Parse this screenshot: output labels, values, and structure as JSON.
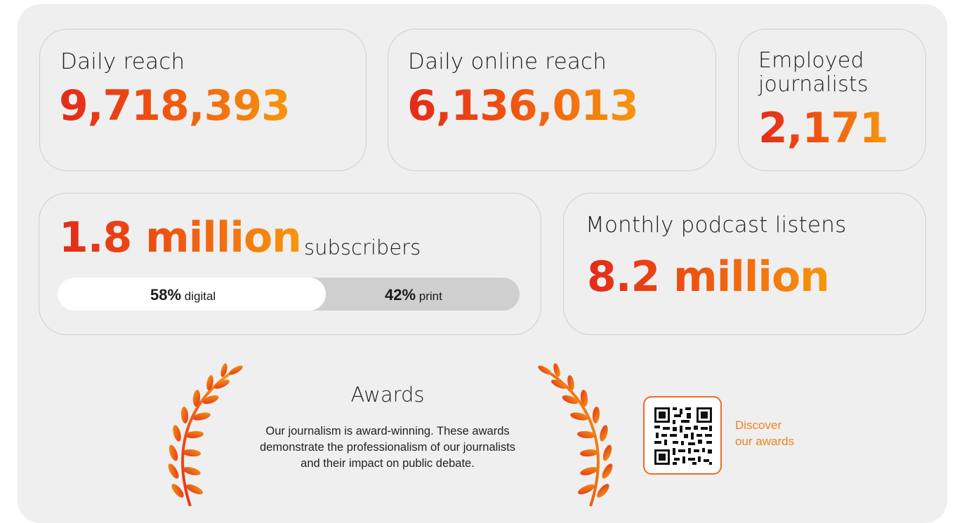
{
  "stats": {
    "daily_reach": {
      "label": "Daily reach",
      "value": "9,718,393"
    },
    "daily_online_reach": {
      "label": "Daily online reach",
      "value": "6,136,013"
    },
    "employed_journalists": {
      "label_line1": "Employed",
      "label_line2": "journalists",
      "value": "2,171"
    },
    "subscribers": {
      "value": "1.8 million",
      "label": "subscribers",
      "digital_percent": "58%",
      "digital_label": "digital",
      "print_percent": "42%",
      "print_label": "print",
      "digital_fraction": 0.58
    },
    "podcast": {
      "label": "Monthly podcast listens",
      "value": "8.2 million"
    }
  },
  "awards": {
    "title": "Awards",
    "description_line1": "Our journalism is award-winning. These awards",
    "description_line2": "demonstrate the professionalism of our journalists",
    "description_line3": "and their impact on public debate.",
    "link_line1": "Discover",
    "link_line2": "our awards",
    "qr_icon": "qr-code-icon"
  },
  "colors": {
    "gradient_start": "#e32a1a",
    "gradient_mid": "#ee5410",
    "gradient_end": "#f7970e",
    "panel_bg": "#efefef",
    "link": "#ee8420"
  }
}
